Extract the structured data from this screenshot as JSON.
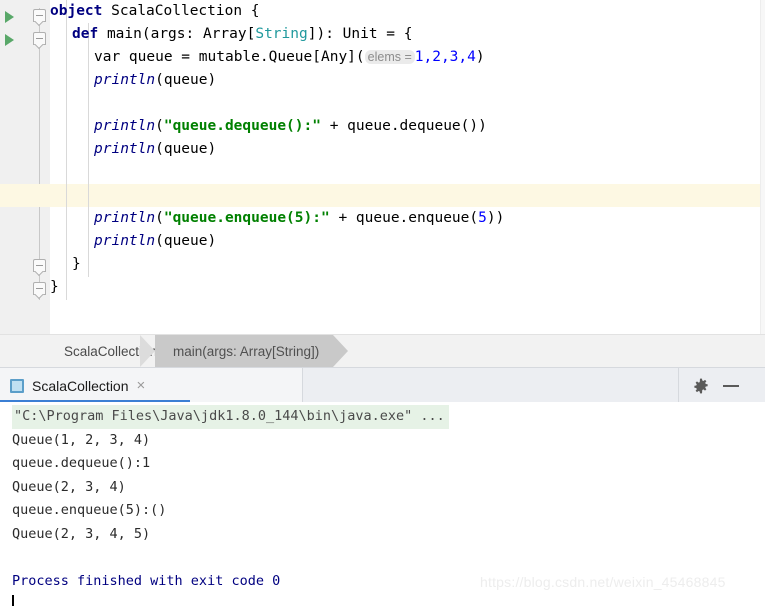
{
  "editor": {
    "language": "scala",
    "caret_line_index": 8,
    "gutter_run_markers": [
      "run-icon",
      "run-icon"
    ],
    "lines": [
      {
        "indent": 0,
        "tokens": [
          {
            "t": "object",
            "c": "kw"
          },
          {
            "t": " ",
            "c": "plain"
          },
          {
            "t": "ScalaCollection",
            "c": "plain"
          },
          {
            "t": " {",
            "c": "plain"
          }
        ]
      },
      {
        "indent": 1,
        "tokens": [
          {
            "t": "def",
            "c": "kw"
          },
          {
            "t": " ",
            "c": "plain"
          },
          {
            "t": "main(args: Array[",
            "c": "plain"
          },
          {
            "t": "String",
            "c": "type"
          },
          {
            "t": "]): Unit = {",
            "c": "plain"
          }
        ]
      },
      {
        "indent": 2,
        "tokens": [
          {
            "t": "var",
            "c": "plain"
          },
          {
            "t": " queue = mutable.Queue[Any](",
            "c": "plain"
          },
          {
            "t": "elems =",
            "c": "hint"
          },
          {
            "t": "1,2,3,4",
            "c": "num"
          },
          {
            "t": ")",
            "c": "plain"
          }
        ]
      },
      {
        "indent": 2,
        "tokens": [
          {
            "t": "println",
            "c": "fn"
          },
          {
            "t": "(queue)",
            "c": "plain"
          }
        ]
      },
      {
        "indent": 2,
        "tokens": []
      },
      {
        "indent": 2,
        "tokens": [
          {
            "t": "println",
            "c": "fn"
          },
          {
            "t": "(",
            "c": "plain"
          },
          {
            "t": "\"queue.dequeue():\"",
            "c": "str"
          },
          {
            "t": " + queue.dequeue())",
            "c": "plain"
          }
        ]
      },
      {
        "indent": 2,
        "tokens": [
          {
            "t": "println",
            "c": "fn"
          },
          {
            "t": "(queue)",
            "c": "plain"
          }
        ]
      },
      {
        "indent": 2,
        "tokens": []
      },
      {
        "indent": 2,
        "tokens": []
      },
      {
        "indent": 2,
        "tokens": [
          {
            "t": "println",
            "c": "fn"
          },
          {
            "t": "(",
            "c": "plain"
          },
          {
            "t": "\"queue.enqueue(5):\"",
            "c": "str"
          },
          {
            "t": " + queue.enqueue(",
            "c": "plain"
          },
          {
            "t": "5",
            "c": "num"
          },
          {
            "t": "))",
            "c": "plain"
          }
        ]
      },
      {
        "indent": 2,
        "tokens": [
          {
            "t": "println",
            "c": "fn"
          },
          {
            "t": "(queue)",
            "c": "plain"
          }
        ]
      },
      {
        "indent": 1,
        "tokens": [
          {
            "t": "}",
            "c": "plain"
          }
        ]
      },
      {
        "indent": 0,
        "tokens": [
          {
            "t": "}",
            "c": "plain"
          }
        ]
      }
    ]
  },
  "breadcrumb": {
    "items": [
      {
        "label": "ScalaCollection",
        "active": false
      },
      {
        "label": "main(args: Array[String])",
        "active": true
      }
    ]
  },
  "run_panel": {
    "tab": {
      "label": "ScalaCollection",
      "close_label": "×",
      "icon": "run-configuration-icon"
    },
    "toolbar": {
      "settings_label": "gear-icon",
      "minimize_label": "minimize-icon"
    },
    "console": {
      "command_line": "\"C:\\Program Files\\Java\\jdk1.8.0_144\\bin\\java.exe\" ...",
      "output_lines": [
        {
          "text": "Queue(1, 2, 3, 4)",
          "style": "normal"
        },
        {
          "text": "queue.dequeue():1",
          "style": "normal"
        },
        {
          "text": "Queue(2, 3, 4)",
          "style": "normal"
        },
        {
          "text": "queue.enqueue(5):()",
          "style": "normal"
        },
        {
          "text": "Queue(2, 3, 4, 5)",
          "style": "normal"
        },
        {
          "text": "",
          "style": "normal"
        },
        {
          "text": "Process finished with exit code 0",
          "style": "exit"
        }
      ]
    }
  },
  "watermark": {
    "text": "https://blog.csdn.net/weixin_45468845"
  },
  "colors": {
    "keyword": "#000080",
    "type": "#20999d",
    "string": "#008000",
    "number": "#0000ff",
    "caret_line": "#fdf8e3",
    "command_bg": "#e6f2e6",
    "tab_underline": "#3b7fd4",
    "run_arrow": "#59a869"
  }
}
